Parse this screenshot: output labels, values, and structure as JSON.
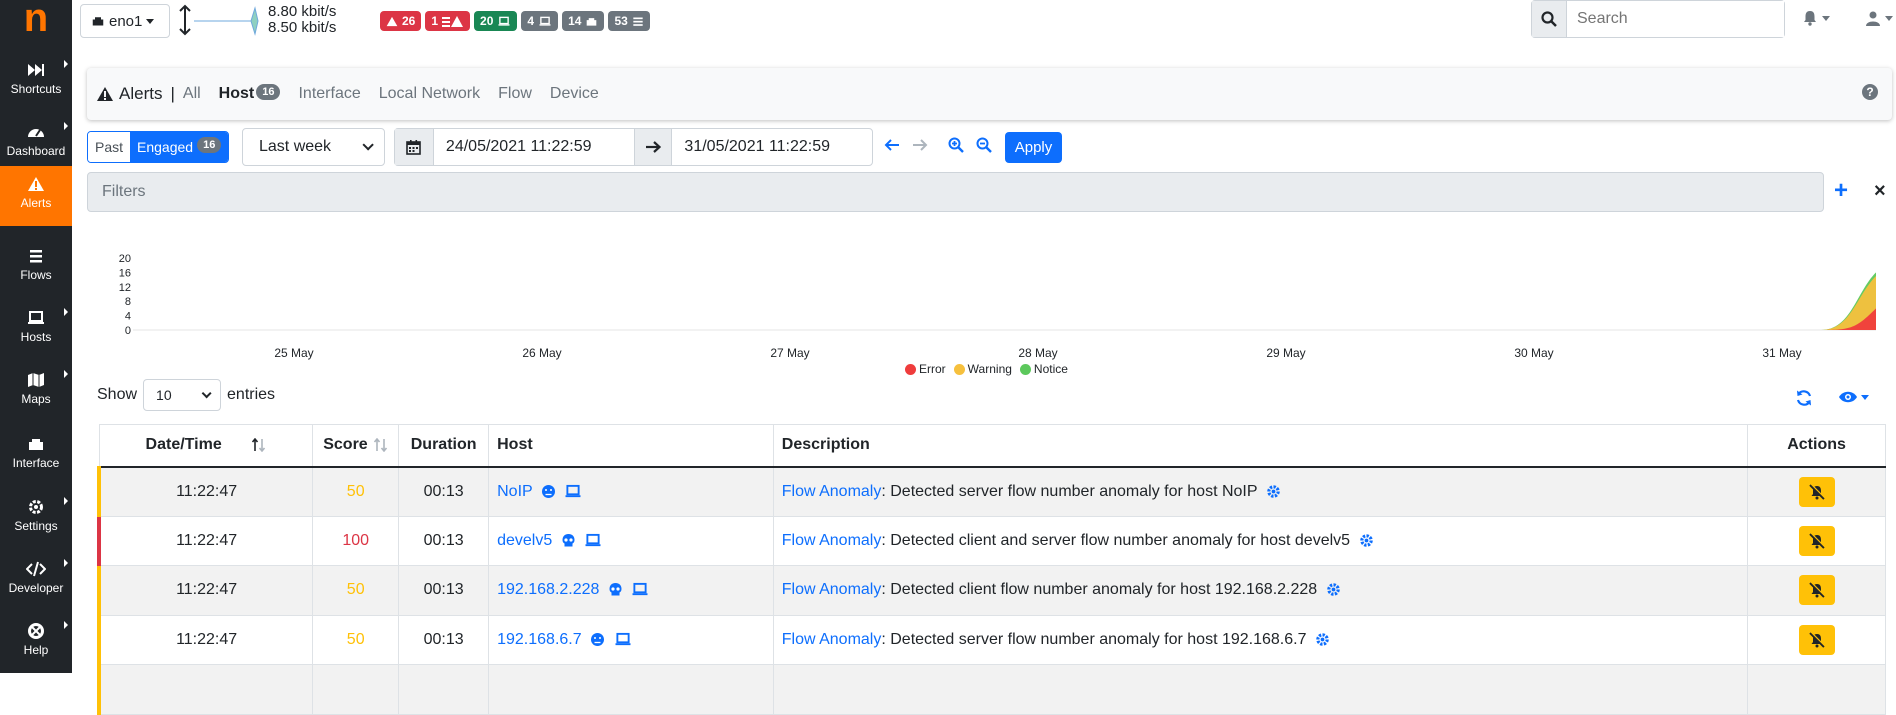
{
  "sidebar": {
    "logo": "n",
    "items": [
      {
        "label": "Shortcuts",
        "icon": "forward-icon"
      },
      {
        "label": "Dashboard",
        "icon": "gauge-icon"
      },
      {
        "label": "Alerts",
        "icon": "alert-triangle-icon"
      },
      {
        "label": "Flows",
        "icon": "stream-icon"
      },
      {
        "label": "Hosts",
        "icon": "laptop-icon"
      },
      {
        "label": "Maps",
        "icon": "map-icon"
      },
      {
        "label": "Interface",
        "icon": "ethernet-icon"
      },
      {
        "label": "Settings",
        "icon": "gear-icon"
      },
      {
        "label": "Developer",
        "icon": "code-icon"
      },
      {
        "label": "Help",
        "icon": "lifering-icon"
      }
    ]
  },
  "topbar": {
    "interface": "eno1",
    "rate_up": "8.80 kbit/s",
    "rate_down": "8.50 kbit/s",
    "badges": [
      {
        "value": "26",
        "color": "#dc3545",
        "icon": "alert-triangle-icon",
        "prefix": ""
      },
      {
        "value": "1",
        "color": "#dc3545",
        "icon": "list-alert-icon",
        "prefix": "1"
      },
      {
        "value": "20",
        "color": "#198754",
        "icon": "laptop-icon"
      },
      {
        "value": "4",
        "color": "#6c757d",
        "icon": "laptop-icon"
      },
      {
        "value": "14",
        "color": "#6c757d",
        "icon": "ethernet-icon"
      },
      {
        "value": "53",
        "color": "#6c757d",
        "icon": "stream-icon"
      }
    ],
    "search_placeholder": "Search"
  },
  "tabs": {
    "title": "Alerts",
    "separator": "|",
    "items": [
      "All",
      "Host",
      "Interface",
      "Local Network",
      "Flow",
      "Device"
    ],
    "host_count": "16"
  },
  "controls": {
    "past": "Past",
    "engaged": "Engaged",
    "engaged_count": "16",
    "period": "Last week",
    "date_from": "24/05/2021 11:22:59",
    "date_to": "31/05/2021 11:22:59",
    "apply": "Apply",
    "filters_placeholder": "Filters"
  },
  "chart_data": {
    "type": "area",
    "x": [
      "25 May",
      "26 May",
      "27 May",
      "28 May",
      "29 May",
      "30 May",
      "31 May"
    ],
    "yticks": [
      20,
      16,
      12,
      8,
      4,
      0
    ],
    "ylim": [
      0,
      20
    ],
    "series": [
      {
        "name": "Error",
        "color": "#ef3c3c",
        "values": [
          0,
          0,
          0,
          0,
          0,
          0,
          6
        ]
      },
      {
        "name": "Warning",
        "color": "#f6c03d",
        "values": [
          0,
          0,
          0,
          0,
          0,
          0,
          9
        ]
      },
      {
        "name": "Notice",
        "color": "#5cc85c",
        "values": [
          0,
          0,
          0,
          0,
          0,
          0,
          1
        ]
      }
    ],
    "legend_placement": "bottom-center"
  },
  "table": {
    "show_label": "Show",
    "entries_label": "entries",
    "page_size": "10",
    "columns": [
      "Date/Time",
      "Score",
      "Duration",
      "Host",
      "Description",
      "Actions"
    ],
    "rows": [
      {
        "time": "11:22:47",
        "score": "50",
        "severity": "warning",
        "duration": "00:13",
        "host": "NoIP",
        "anomaly": "Flow Anomaly",
        "desc": ": Detected server flow number anomaly for host NoIP"
      },
      {
        "time": "11:22:47",
        "score": "100",
        "severity": "error",
        "duration": "00:13",
        "host": "develv5",
        "anomaly": "Flow Anomaly",
        "desc": ": Detected client and server flow number anomaly for host develv5"
      },
      {
        "time": "11:22:47",
        "score": "50",
        "severity": "warning",
        "duration": "00:13",
        "host": "192.168.2.228",
        "anomaly": "Flow Anomaly",
        "desc": ": Detected client flow number anomaly for host 192.168.2.228"
      },
      {
        "time": "11:22:47",
        "score": "50",
        "severity": "warning",
        "duration": "00:13",
        "host": "192.168.6.7",
        "anomaly": "Flow Anomaly",
        "desc": ": Detected server flow number anomaly for host 192.168.6.7"
      }
    ]
  }
}
